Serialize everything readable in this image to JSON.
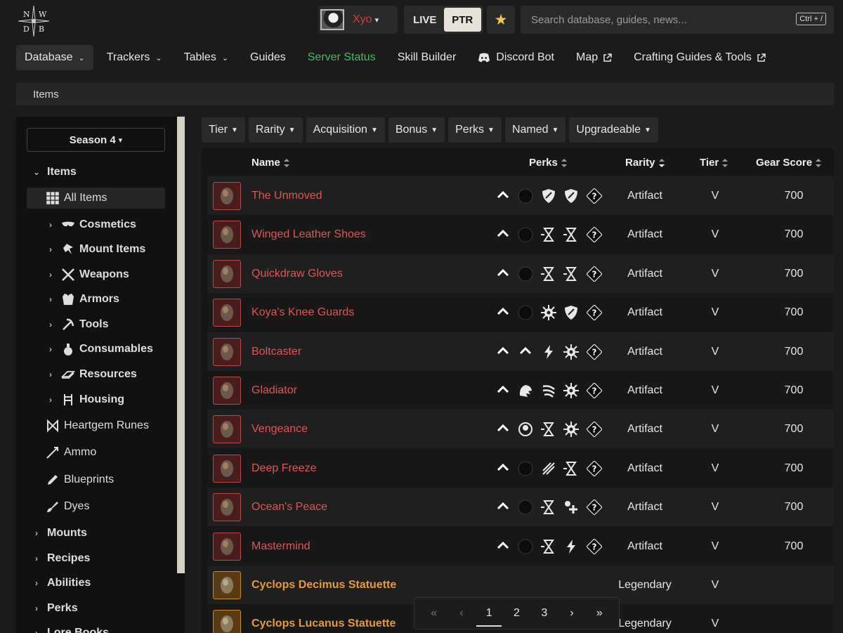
{
  "header": {
    "logo_letters": [
      "N",
      "W",
      "D",
      "B"
    ],
    "username": "Xyo",
    "env": {
      "live": "LIVE",
      "ptr": "PTR",
      "active": "PTR"
    },
    "search": {
      "placeholder": "Search database, guides, news...",
      "shortcut": "Ctrl + /"
    }
  },
  "nav": [
    {
      "label": "Database",
      "dropdown": true,
      "active": true
    },
    {
      "label": "Trackers",
      "dropdown": true
    },
    {
      "label": "Tables",
      "dropdown": true
    },
    {
      "label": "Guides"
    },
    {
      "label": "Server Status",
      "color": "#3fbf5f"
    },
    {
      "label": "Skill Builder"
    },
    {
      "label": "Discord Bot",
      "icon": "discord-icon"
    },
    {
      "label": "Map",
      "external": true
    },
    {
      "label": "Crafting Guides & Tools",
      "external": true
    }
  ],
  "breadcrumb": "Items",
  "sidebar": {
    "season": "Season 4",
    "items_label": "Items",
    "all_items": "All Items",
    "categories": [
      {
        "label": "Cosmetics",
        "icon": "mask-icon"
      },
      {
        "label": "Mount Items",
        "icon": "mount-icon"
      },
      {
        "label": "Weapons",
        "icon": "crossed-swords-icon"
      },
      {
        "label": "Armors",
        "icon": "armor-icon"
      },
      {
        "label": "Tools",
        "icon": "pickaxe-icon"
      },
      {
        "label": "Consumables",
        "icon": "potion-icon"
      },
      {
        "label": "Resources",
        "icon": "resource-icon"
      },
      {
        "label": "Housing",
        "icon": "chair-icon"
      }
    ],
    "leaf_items": [
      {
        "label": "Heartgem Runes",
        "icon": "rune-icon"
      },
      {
        "label": "Ammo",
        "icon": "arrow-icon"
      },
      {
        "label": "Blueprints",
        "icon": "pencil-icon"
      },
      {
        "label": "Dyes",
        "icon": "brush-icon"
      }
    ],
    "top_sections": [
      "Mounts",
      "Recipes",
      "Abilities",
      "Perks",
      "Lore Books"
    ]
  },
  "filters": [
    "Tier",
    "Rarity",
    "Acquisition",
    "Bonus",
    "Perks",
    "Named",
    "Upgradeable"
  ],
  "table": {
    "columns": {
      "name": "Name",
      "perks": "Perks",
      "rarity": "Rarity",
      "tier": "Tier",
      "gear_score": "Gear Score"
    },
    "rows": [
      {
        "name": "The Unmoved",
        "rarity": "Artifact",
        "tier": "V",
        "gear_score": "700",
        "perks": [
          "chevron-up-icon",
          "empty-socket-icon",
          "shield-icon",
          "shield-icon",
          "unknown-perk-icon"
        ]
      },
      {
        "name": "Winged Leather Shoes",
        "rarity": "Artifact",
        "tier": "V",
        "gear_score": "700",
        "perks": [
          "chevron-up-icon",
          "empty-socket-icon",
          "hourglass-icon",
          "hourglass-icon",
          "unknown-perk-icon"
        ]
      },
      {
        "name": "Quickdraw Gloves",
        "rarity": "Artifact",
        "tier": "V",
        "gear_score": "700",
        "perks": [
          "chevron-up-icon",
          "empty-socket-icon",
          "hourglass-icon",
          "hourglass-icon",
          "unknown-perk-icon"
        ]
      },
      {
        "name": "Koya's Knee Guards",
        "rarity": "Artifact",
        "tier": "V",
        "gear_score": "700",
        "perks": [
          "chevron-up-icon",
          "empty-socket-icon",
          "gear-burst-icon",
          "shield-icon",
          "unknown-perk-icon"
        ]
      },
      {
        "name": "Boltcaster",
        "rarity": "Artifact",
        "tier": "V",
        "gear_score": "700",
        "perks": [
          "chevron-up-icon",
          "chevron-up-icon",
          "lightning-icon",
          "gear-burst-icon",
          "unknown-perk-icon"
        ]
      },
      {
        "name": "Gladiator",
        "rarity": "Artifact",
        "tier": "V",
        "gear_score": "700",
        "perks": [
          "chevron-up-icon",
          "beast-icon",
          "claw-icon",
          "gear-burst-icon",
          "unknown-perk-icon"
        ]
      },
      {
        "name": "Vengeance",
        "rarity": "Artifact",
        "tier": "V",
        "gear_score": "700",
        "perks": [
          "chevron-up-icon",
          "face-icon",
          "hourglass-icon",
          "gear-burst-icon",
          "unknown-perk-icon"
        ]
      },
      {
        "name": "Deep Freeze",
        "rarity": "Artifact",
        "tier": "V",
        "gear_score": "700",
        "perks": [
          "chevron-up-icon",
          "empty-socket-icon",
          "sword-slash-icon",
          "hourglass-icon",
          "unknown-perk-icon"
        ]
      },
      {
        "name": "Ocean's Peace",
        "rarity": "Artifact",
        "tier": "V",
        "gear_score": "700",
        "perks": [
          "chevron-up-icon",
          "empty-socket-icon",
          "hourglass-icon",
          "heal-plus-icon",
          "unknown-perk-icon"
        ]
      },
      {
        "name": "Mastermind",
        "rarity": "Artifact",
        "tier": "V",
        "gear_score": "700",
        "perks": [
          "chevron-up-icon",
          "empty-socket-icon",
          "hourglass-icon",
          "lightning-icon",
          "unknown-perk-icon"
        ]
      },
      {
        "name": "Cyclops Decimus Statuette",
        "rarity": "Legendary",
        "tier": "V",
        "gear_score": "",
        "perks": []
      },
      {
        "name": "Cyclops Lucanus Statuette",
        "rarity": "Legendary",
        "tier": "V",
        "gear_score": "",
        "perks": []
      }
    ]
  },
  "pagination": {
    "first": "«",
    "prev": "‹",
    "pages": [
      "1",
      "2",
      "3"
    ],
    "current": "1",
    "next": "›",
    "last": "»"
  },
  "colors": {
    "artifact": "#e05555",
    "legendary": "#e59b3a",
    "server_status": "#3fbf5f",
    "favorite": "#f2c94c"
  }
}
